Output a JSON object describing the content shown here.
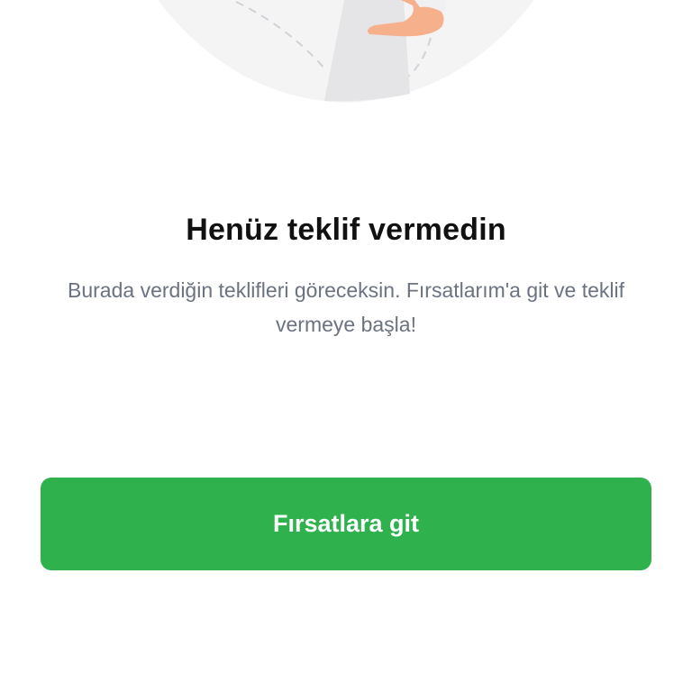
{
  "empty_state": {
    "illustration": "person-with-circle-illustration",
    "title": "Henüz teklif vermedin",
    "description": "Burada verdiğin teklifleri göreceksin. Fırsatlarım'a git ve teklif vermeye başla!"
  },
  "cta": {
    "label": "Fırsatlara git",
    "color": "#2fb24e"
  }
}
